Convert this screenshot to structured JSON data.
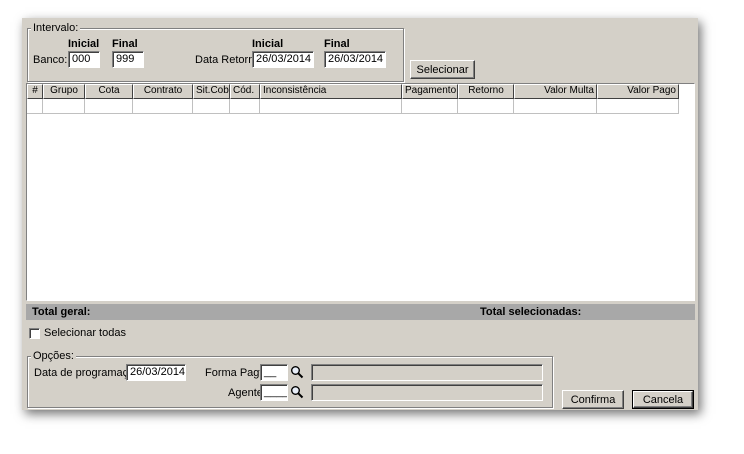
{
  "intervalo": {
    "legend": "Intervalo:",
    "inicial_label": "Inicial",
    "final_label": "Final",
    "banco_label": "Banco:",
    "banco_inicial": "000",
    "banco_final": "999",
    "data_retorno_label": "Data Retorno:",
    "data_inicial": "26/03/2014",
    "data_final": "26/03/2014"
  },
  "selecionar_label": "Selecionar",
  "table": {
    "columns": [
      "#",
      "Grupo",
      "Cota",
      "Contrato",
      "Sit.Cobr.",
      "Cód.",
      "Inconsistência",
      "Pagamento",
      "Retorno",
      "Valor Multa",
      "Valor Pago"
    ]
  },
  "totals": {
    "geral_label": "Total geral:",
    "selecionadas_label": "Total selecionadas:"
  },
  "selecionar_todas_label": "Selecionar todas",
  "opcoes": {
    "legend": "Opções:",
    "data_programacao_label": "Data de programação:",
    "data_programacao": "26/03/2014",
    "forma_pagto_label": "Forma Pagto:",
    "forma_pagto": "__",
    "agente_label": "Agente:",
    "agente": "____"
  },
  "buttons": {
    "confirma": "Confirma",
    "cancela": "Cancela"
  }
}
